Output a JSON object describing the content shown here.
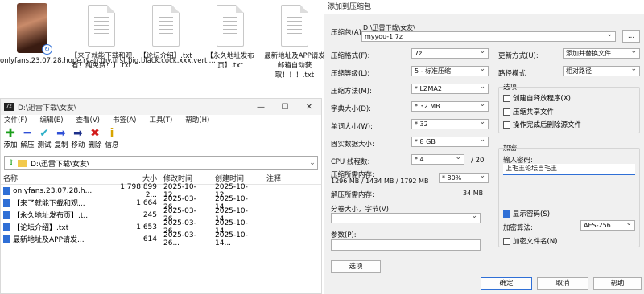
{
  "desktop": {
    "icons": [
      {
        "label": "onlyfans.23.07.28.hope.ryan.my.first.big.black.cock.xxx.verti...",
        "type": "video"
      },
      {
        "label": "【来了就能下载和观看！纯免费！】.txt",
        "type": "txt"
      },
      {
        "label": "【论坛介绍】.txt",
        "type": "txt"
      },
      {
        "label": "【永久地址发布页】.txt",
        "type": "txt"
      },
      {
        "label": "最新地址及APP请发邮箱自动获取！！！.txt",
        "type": "txt"
      }
    ]
  },
  "file_manager": {
    "title": "D:\\迅雷下载\\女友\\",
    "app_icon": "7z",
    "window_controls": [
      "—",
      "☐",
      "✕"
    ],
    "menu": [
      "文件(F)",
      "编辑(E)",
      "查看(V)",
      "书签(A)",
      "工具(T)",
      "帮助(H)"
    ],
    "toolbar": [
      {
        "label": "添加",
        "icon": "add-icon",
        "glyph": "✚",
        "color": "#1a9e1a"
      },
      {
        "label": "解压",
        "icon": "extract-icon",
        "glyph": "━",
        "color": "#2f4fd6"
      },
      {
        "label": "测试",
        "icon": "test-icon",
        "glyph": "✔",
        "color": "#2fb0c8"
      },
      {
        "label": "复制",
        "icon": "copy-icon",
        "glyph": "➡",
        "color": "#2f4fd6"
      },
      {
        "label": "移动",
        "icon": "move-icon",
        "glyph": "➡",
        "color": "#1c2f8a"
      },
      {
        "label": "删除",
        "icon": "delete-icon",
        "glyph": "✖",
        "color": "#d21c1c"
      },
      {
        "label": "信息",
        "icon": "info-icon",
        "glyph": "i",
        "color": "#d8a400"
      }
    ],
    "address": "D:\\迅雷下载\\女友\\",
    "columns": [
      "名称",
      "大小",
      "修改时间",
      "创建时间",
      "注释"
    ],
    "rows": [
      {
        "name": "onlyfans.23.07.28.h...",
        "size": "1 798 899 2...",
        "modified": "2025-10-12...",
        "created": "2025-10-12..."
      },
      {
        "name": "【来了就能下载和观...",
        "size": "1 664",
        "modified": "2025-03-26...",
        "created": "2025-10-14..."
      },
      {
        "name": "【永久地址发布页】.t...",
        "size": "245",
        "modified": "2025-03-26...",
        "created": "2025-10-14..."
      },
      {
        "name": "【论坛介绍】.txt",
        "size": "1 653",
        "modified": "2025-03-26...",
        "created": "2025-10-14..."
      },
      {
        "name": "最新地址及APP请发...",
        "size": "614",
        "modified": "2025-03-26...",
        "created": "2025-10-14..."
      }
    ]
  },
  "dialog": {
    "title": "添加到压缩包",
    "archive_label": "压缩包(A):",
    "archive_dir": "D:\\迅雷下载\\女友\\",
    "archive_name": "myyou-1.7z",
    "browse": "...",
    "format_label": "压缩格式(F):",
    "format_value": "7z",
    "level_label": "压缩等级(L):",
    "level_value": "5 - 标准压缩",
    "method_label": "压缩方法(M):",
    "method_value": "* LZMA2",
    "dict_label": "字典大小(D):",
    "dict_value": "* 32 MB",
    "word_label": "单词大小(W):",
    "word_value": "* 32",
    "solid_label": "固实数据大小:",
    "solid_value": "* 8 GB",
    "cpu_label": "CPU 线程数:",
    "cpu_value": "* 4",
    "cpu_total": "/ 20",
    "mem_comp_label": "压缩所需内存:",
    "mem_comp_detail": "1296 MB / 1434 MB / 1792 MB",
    "mem_comp_value": "* 80%",
    "mem_decomp_label": "解压所需内存:",
    "mem_decomp_value": "34 MB",
    "split_label": "分卷大小，字节(V):",
    "split_value": "",
    "params_label": "参数(P):",
    "params_value": "",
    "options_button": "选项",
    "update_label": "更新方式(U):",
    "update_value": "添加并替换文件",
    "path_label": "路径模式",
    "path_value": "相对路径",
    "options_group": "选项",
    "opt_sfx": "创建自释放程序(X)",
    "opt_shared": "压缩共享文件",
    "opt_delete": "操作完成后删除源文件",
    "enc_group": "加密",
    "pwd_label": "输入密码:",
    "pwd_value": "上毛王论坛当毛王",
    "show_pwd": "显示密码(S)",
    "enc_method_label": "加密算法:",
    "enc_method_value": "AES-256",
    "enc_names": "加密文件名(N)",
    "ok": "确定",
    "cancel": "取消",
    "help": "帮助"
  }
}
